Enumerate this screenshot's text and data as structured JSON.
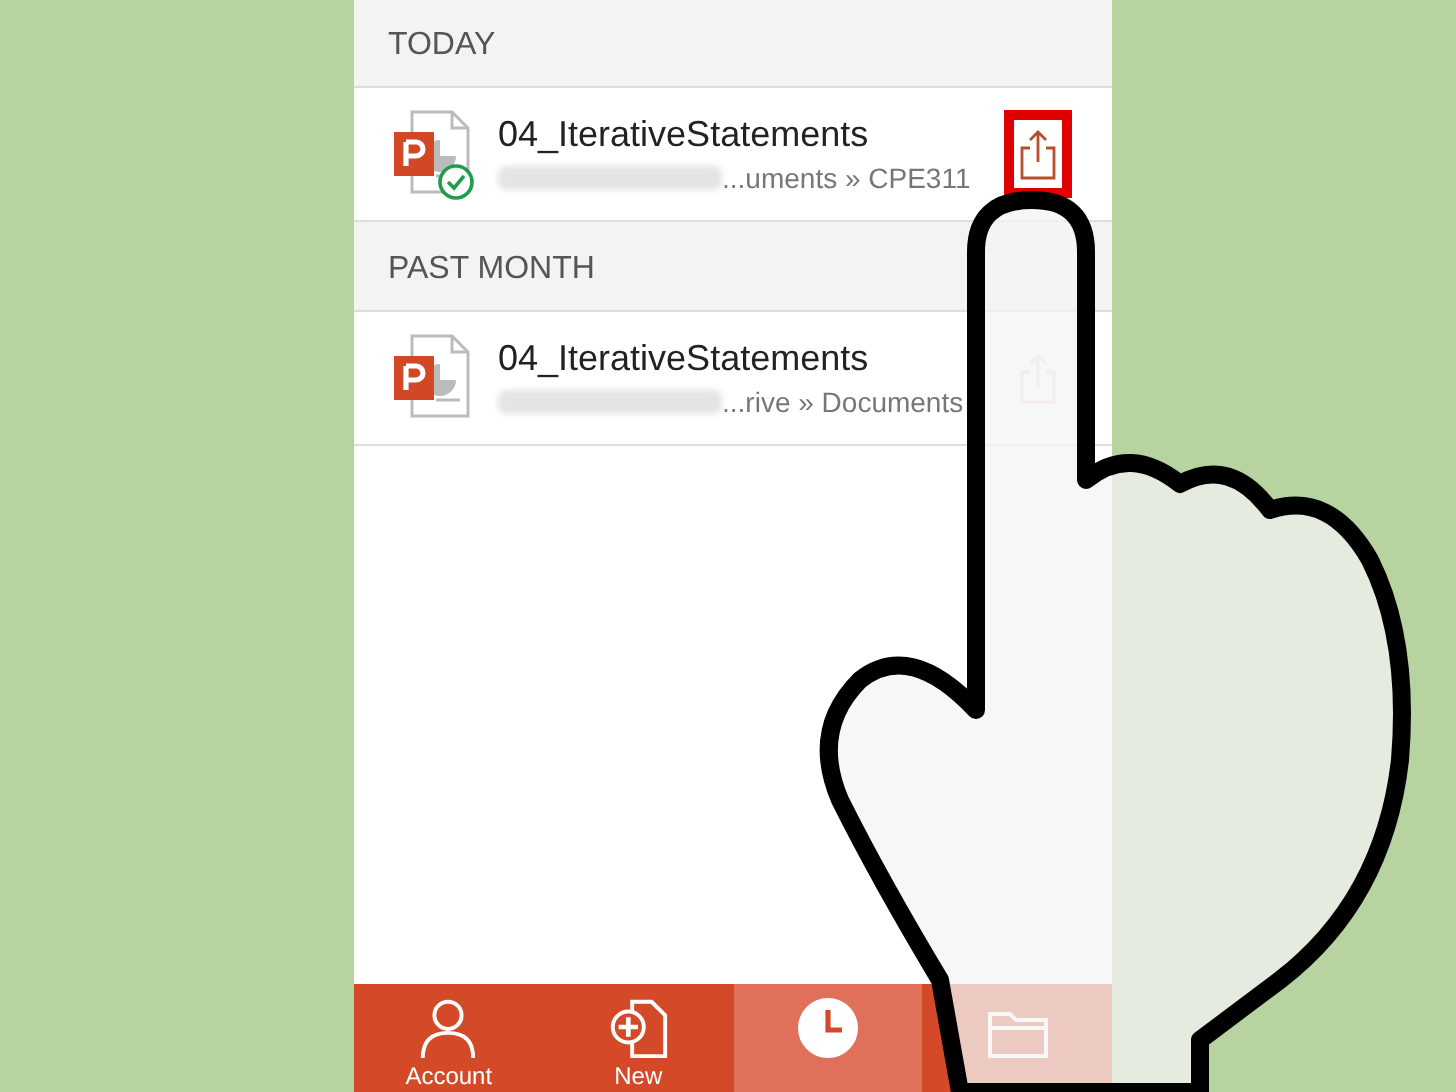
{
  "sections": [
    {
      "header": "TODAY",
      "files": [
        {
          "name": "04_IterativeStatements",
          "path": "...uments » CPE311",
          "synced": true,
          "highlighted": true,
          "share_disabled": false
        }
      ]
    },
    {
      "header": "PAST MONTH",
      "files": [
        {
          "name": "04_IterativeStatements",
          "path": "...rive » Documents",
          "synced": false,
          "highlighted": false,
          "share_disabled": true
        }
      ]
    }
  ],
  "tab_bar": [
    {
      "kind": "account",
      "label": "Account",
      "selected": false
    },
    {
      "kind": "new",
      "label": "New",
      "selected": false
    },
    {
      "kind": "recent",
      "selected": true
    },
    {
      "kind": "open",
      "selected": false
    }
  ]
}
